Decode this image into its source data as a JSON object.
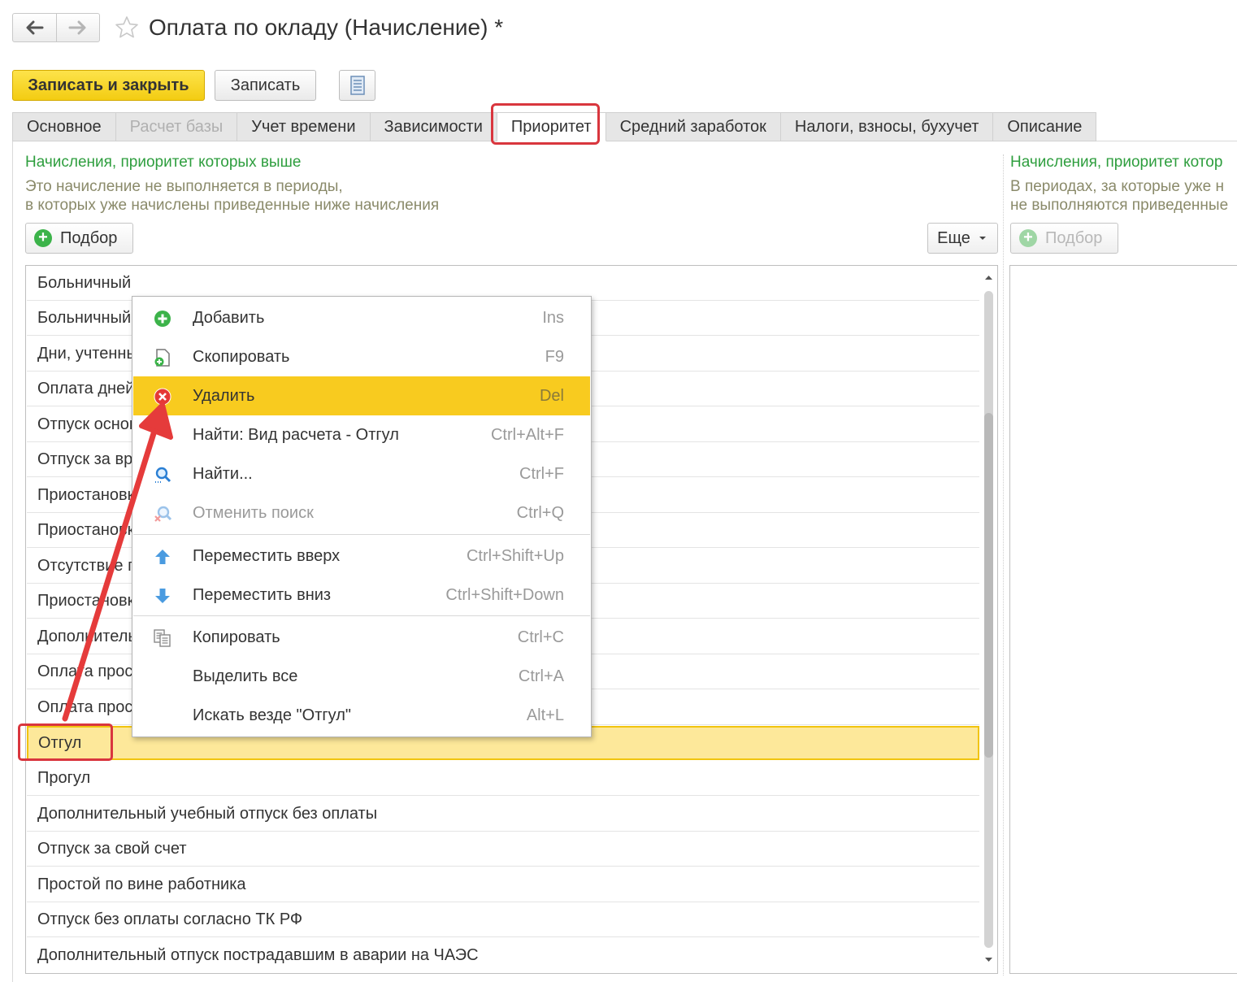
{
  "window": {
    "title": "Оплата по окладу (Начисление) *"
  },
  "toolbar": {
    "save_close_label": "Записать и закрыть",
    "save_label": "Записать"
  },
  "tabs": [
    {
      "label": "Основное",
      "state": "normal"
    },
    {
      "label": "Расчет базы",
      "state": "disabled"
    },
    {
      "label": "Учет времени",
      "state": "normal"
    },
    {
      "label": "Зависимости",
      "state": "normal"
    },
    {
      "label": "Приоритет",
      "state": "active"
    },
    {
      "label": "Средний заработок",
      "state": "normal"
    },
    {
      "label": "Налоги, взносы, бухучет",
      "state": "normal"
    },
    {
      "label": "Описание",
      "state": "normal"
    }
  ],
  "left_panel": {
    "title": "Начисления, приоритет которых выше",
    "desc_line1": "Это начисление не выполняется в периоды,",
    "desc_line2": "в которых уже начислены приведенные ниже начисления",
    "pick_label": "Подбор",
    "more_label": "Еще",
    "rows": [
      "Больничный",
      "Больничный",
      "Дни, учтенны",
      "Оплата дней",
      "Отпуск основ",
      "Отпуск за вр",
      "Приостановк",
      "Приостановк",
      "Отсутствие г",
      "Приостановк",
      "Дополнитель",
      "Оплата прос",
      "Оплата прос",
      "Отгул",
      "Прогул",
      "Дополнительный учебный отпуск без оплаты",
      "Отпуск за свой счет",
      "Простой по вине работника",
      "Отпуск без оплаты согласно ТК РФ",
      "Дополнительный отпуск пострадавшим в аварии на ЧАЭС"
    ],
    "selected_row": "Отгул"
  },
  "right_panel": {
    "title": "Начисления, приоритет котор",
    "desc_line1": "В периодах, за которые уже н",
    "desc_line2": "не выполняются приведенные",
    "pick_label": "Подбор"
  },
  "context_menu": {
    "items": [
      {
        "label": "Добавить",
        "shortcut": "Ins",
        "icon": "add-icon"
      },
      {
        "label": "Скопировать",
        "shortcut": "F9",
        "icon": "copy-doc-icon"
      },
      {
        "label": "Удалить",
        "shortcut": "Del",
        "icon": "delete-icon",
        "highlighted": true
      },
      {
        "label": "Найти: Вид расчета - Отгул",
        "shortcut": "Ctrl+Alt+F",
        "icon": ""
      },
      {
        "label": "Найти...",
        "shortcut": "Ctrl+F",
        "icon": "search-icon"
      },
      {
        "label": "Отменить поиск",
        "shortcut": "Ctrl+Q",
        "icon": "cancel-search-icon",
        "disabled": true
      },
      {
        "label": "Переместить вверх",
        "shortcut": "Ctrl+Shift+Up",
        "icon": "arrow-up-icon"
      },
      {
        "label": "Переместить вниз",
        "shortcut": "Ctrl+Shift+Down",
        "icon": "arrow-down-icon"
      },
      {
        "label": "Копировать",
        "shortcut": "Ctrl+C",
        "icon": "clipboard-copy-icon"
      },
      {
        "label": "Выделить все",
        "shortcut": "Ctrl+A",
        "icon": ""
      },
      {
        "label": "Искать везде \"Отгул\"",
        "shortcut": "Alt+L",
        "icon": ""
      }
    ]
  },
  "colors": {
    "accent_yellow": "#f3cc12",
    "highlight_red": "#d9363e",
    "section_green": "#2e9e3e"
  }
}
